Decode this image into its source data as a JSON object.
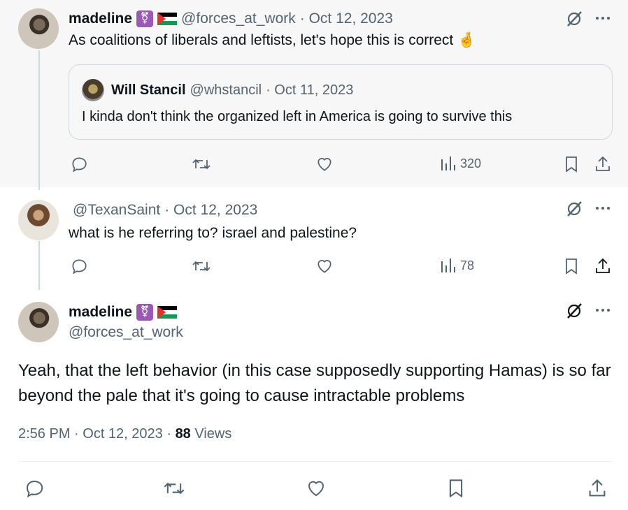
{
  "tweet1": {
    "name": "madeline",
    "badge": "⚧",
    "handle": "@forces_at_work",
    "date": "· Oct 12, 2023",
    "text": "As coalitions of liberals and leftists, let's hope this is correct",
    "emoji": "🤞",
    "views": "320",
    "quoted": {
      "name": "Will Stancil",
      "handle": "@whstancil",
      "date": "· Oct 11, 2023",
      "text": "I kinda don't think the organized left in America is going to survive this"
    }
  },
  "tweet2": {
    "handle": "@TexanSaint",
    "date": "· Oct 12, 2023",
    "text": "what is he referring to? israel and palestine?",
    "views": "78"
  },
  "main": {
    "name": "madeline",
    "badge": "⚧",
    "handle": "@forces_at_work",
    "text": "Yeah, that the left behavior (in this case supposedly supporting Hamas) is so far beyond the pale that it's going to cause intractable problems",
    "time": "2:56 PM · Oct 12, 2023 ·",
    "views_count": "88",
    "views_label": "Views"
  },
  "icons": {
    "reply": "reply-icon",
    "retweet": "retweet-icon",
    "like": "heart-icon",
    "views": "bar-chart-icon",
    "bookmark": "bookmark-icon",
    "share": "share-icon",
    "more": "more-icon",
    "grok": "grok-icon"
  },
  "colors": {
    "muted": "#536471",
    "border": "#cfd9de",
    "badge": "#9b59b6"
  }
}
